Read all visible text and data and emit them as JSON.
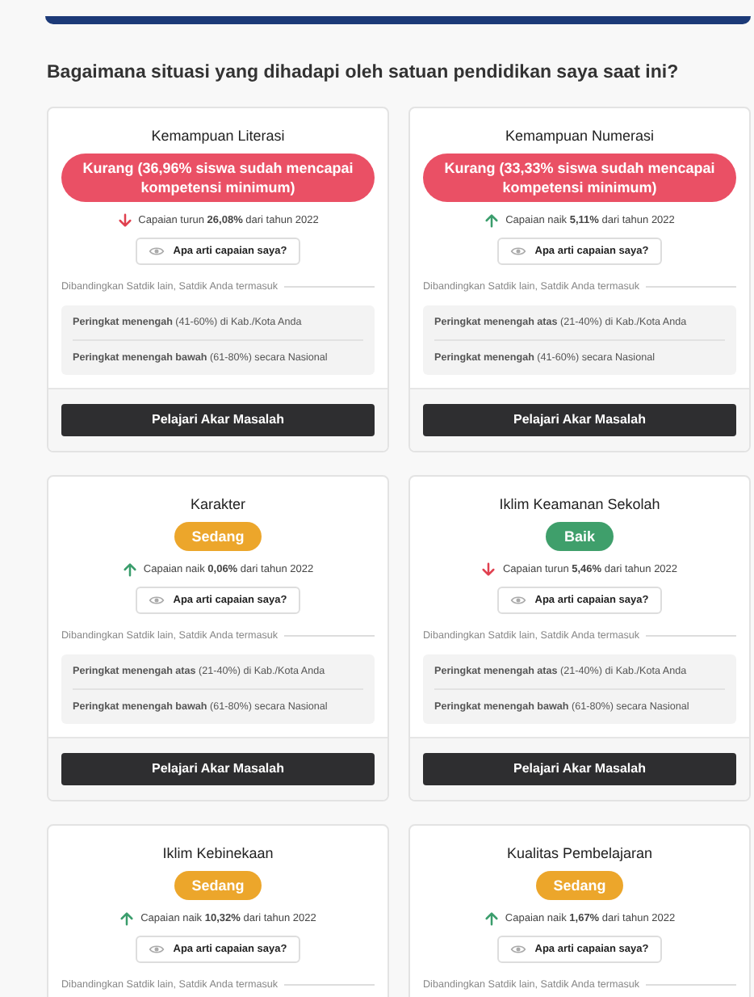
{
  "heading": "Bagaimana situasi yang dihadapi oleh satuan pendidikan saya saat ini?",
  "cards": [
    {
      "title": "Kemampuan Literasi",
      "status": {
        "kind": "kurang",
        "label": "Kurang (36,96% siswa sudah mencapai kompetensi minimum)"
      },
      "trend": {
        "rising": false,
        "text": "Capaian turun **26,08%** dari tahun 2022"
      },
      "info_button": "Apa arti capaian saya?",
      "compare_label": "Dibandingkan Satdik lain, Satdik Anda termasuk",
      "ranks": [
        "**Peringkat menengah** (41-60%) di Kab./Kota Anda",
        "**Peringkat menengah bawah** (61-80%) secara Nasional"
      ],
      "action": "Pelajari Akar Masalah"
    },
    {
      "title": "Kemampuan Numerasi",
      "status": {
        "kind": "kurang",
        "label": "Kurang (33,33% siswa sudah mencapai kompetensi minimum)"
      },
      "trend": {
        "rising": true,
        "text": "Capaian naik **5,11%** dari tahun 2022"
      },
      "info_button": "Apa arti capaian saya?",
      "compare_label": "Dibandingkan Satdik lain, Satdik Anda termasuk",
      "ranks": [
        "**Peringkat menengah atas** (21-40%) di Kab./Kota Anda",
        "**Peringkat menengah** (41-60%) secara Nasional"
      ],
      "action": "Pelajari Akar Masalah"
    },
    {
      "title": "Karakter",
      "status": {
        "kind": "sedang",
        "label": "Sedang"
      },
      "trend": {
        "rising": true,
        "text": "Capaian naik **0,06%** dari tahun 2022"
      },
      "info_button": "Apa arti capaian saya?",
      "compare_label": "Dibandingkan Satdik lain, Satdik Anda termasuk",
      "ranks": [
        "**Peringkat menengah atas** (21-40%) di Kab./Kota Anda",
        "**Peringkat menengah bawah** (61-80%) secara Nasional"
      ],
      "action": "Pelajari Akar Masalah"
    },
    {
      "title": "Iklim Keamanan Sekolah",
      "status": {
        "kind": "baik",
        "label": "Baik"
      },
      "trend": {
        "rising": false,
        "text": "Capaian turun **5,46%** dari tahun 2022"
      },
      "info_button": "Apa arti capaian saya?",
      "compare_label": "Dibandingkan Satdik lain, Satdik Anda termasuk",
      "ranks": [
        "**Peringkat menengah atas** (21-40%) di Kab./Kota Anda",
        "**Peringkat menengah bawah** (61-80%) secara Nasional"
      ],
      "action": "Pelajari Akar Masalah"
    },
    {
      "title": "Iklim Kebinekaan",
      "status": {
        "kind": "sedang",
        "label": "Sedang"
      },
      "trend": {
        "rising": true,
        "text": "Capaian naik **10,32%** dari tahun 2022"
      },
      "info_button": "Apa arti capaian saya?",
      "compare_label": "Dibandingkan Satdik lain, Satdik Anda termasuk"
    },
    {
      "title": "Kualitas Pembelajaran",
      "status": {
        "kind": "sedang",
        "label": "Sedang"
      },
      "trend": {
        "rising": true,
        "text": "Capaian naik **1,67%** dari tahun 2022"
      },
      "info_button": "Apa arti capaian saya?",
      "compare_label": "Dibandingkan Satdik lain, Satdik Anda termasuk"
    }
  ]
}
